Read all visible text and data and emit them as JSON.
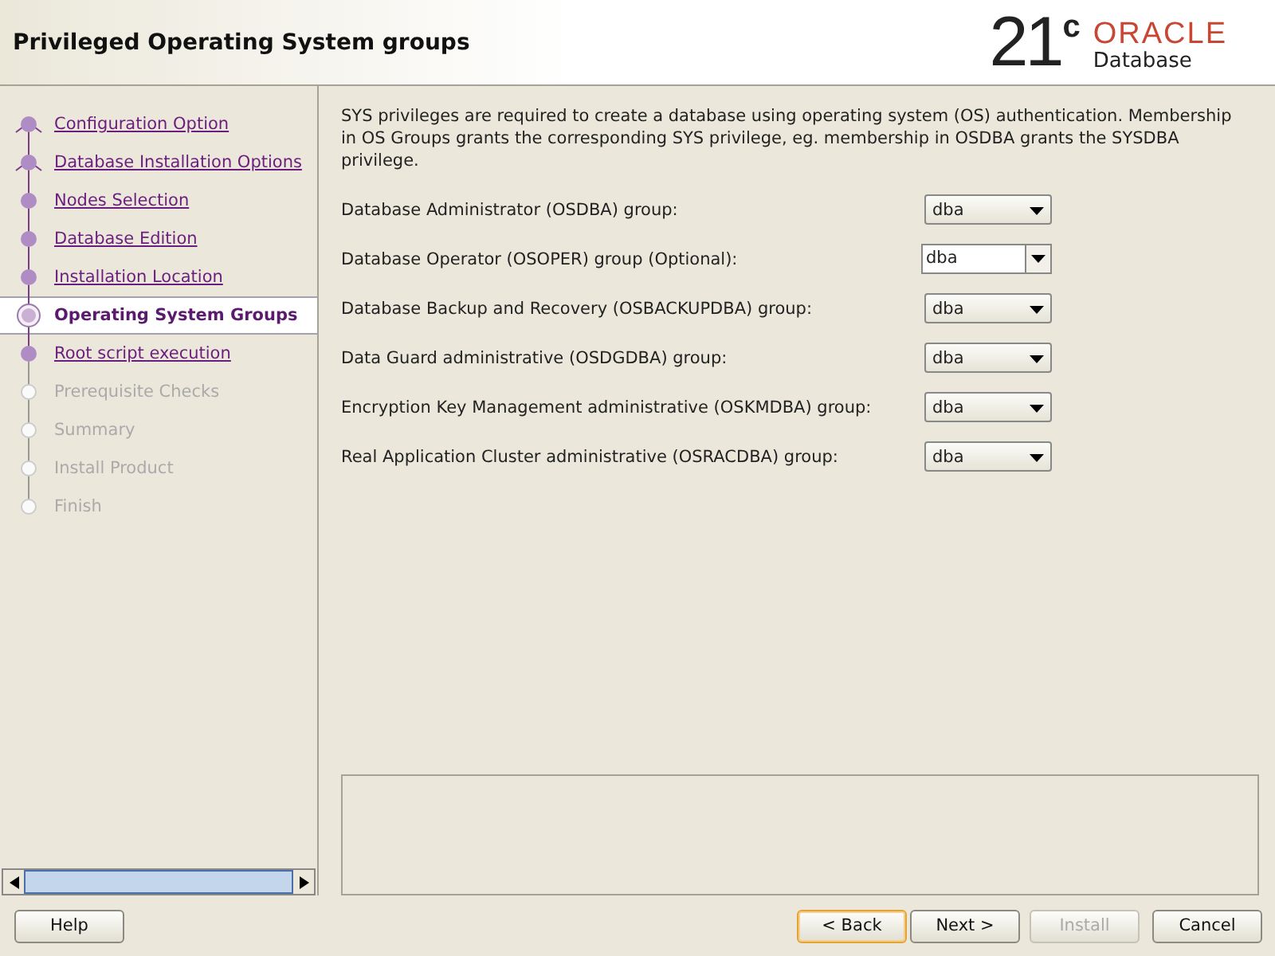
{
  "header": {
    "title": "Privileged Operating System groups",
    "logo": {
      "version": "21",
      "superscript": "c",
      "brand": "ORACLE",
      "product": "Database"
    }
  },
  "steps": [
    {
      "label": "Configuration Option",
      "selected": false,
      "disabled": false
    },
    {
      "label": "Database Installation Options",
      "selected": false,
      "disabled": false
    },
    {
      "label": "Nodes Selection",
      "selected": false,
      "disabled": false
    },
    {
      "label": "Database Edition",
      "selected": false,
      "disabled": false
    },
    {
      "label": "Installation Location",
      "selected": false,
      "disabled": false
    },
    {
      "label": "Operating System Groups",
      "selected": true,
      "disabled": false
    },
    {
      "label": "Root script execution",
      "selected": false,
      "disabled": false
    },
    {
      "label": "Prerequisite Checks",
      "selected": false,
      "disabled": true
    },
    {
      "label": "Summary",
      "selected": false,
      "disabled": true
    },
    {
      "label": "Install Product",
      "selected": false,
      "disabled": true
    },
    {
      "label": "Finish",
      "selected": false,
      "disabled": true
    }
  ],
  "intro": "SYS privileges are required to create a database using operating system (OS) authentication. Membership in OS Groups grants the corresponding SYS privilege, eg. membership in OSDBA grants the SYSDBA privilege.",
  "groups": [
    {
      "label": "Database Administrator (OSDBA) group:",
      "value": "dba",
      "kind": "select"
    },
    {
      "label": "Database Operator (OSOPER) group (Optional):",
      "value": "dba",
      "kind": "editable"
    },
    {
      "label": "Database Backup and Recovery (OSBACKUPDBA) group:",
      "value": "dba",
      "kind": "select"
    },
    {
      "label": "Data Guard administrative (OSDGDBA) group:",
      "value": "dba",
      "kind": "select"
    },
    {
      "label": "Encryption Key Management administrative (OSKMDBA) group:",
      "value": "dba",
      "kind": "select"
    },
    {
      "label": "Real Application Cluster administrative (OSRACDBA) group:",
      "value": "dba",
      "kind": "select"
    }
  ],
  "buttons": [
    {
      "label": "Help",
      "disabled": false,
      "focused": false
    },
    {
      "label": "< Back",
      "disabled": false,
      "focused": true
    },
    {
      "label": "Next >",
      "disabled": false,
      "focused": false
    },
    {
      "label": "Install",
      "disabled": true,
      "focused": false
    },
    {
      "label": "Cancel",
      "disabled": false,
      "focused": false
    }
  ]
}
